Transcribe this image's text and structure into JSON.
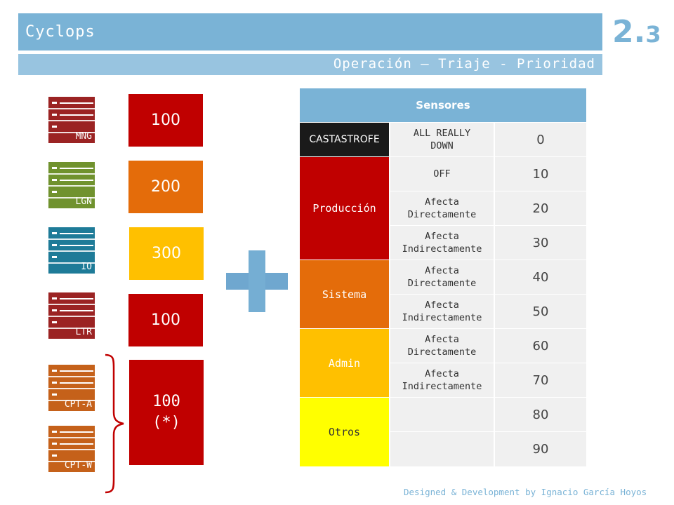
{
  "header": {
    "title": "Cyclops",
    "subtitle": "Operación – Triaje - Prioridad",
    "section_major": "2.",
    "section_minor": "3"
  },
  "colors": {
    "accent": "#7ab3d6",
    "red": "#c00000",
    "orange": "#e46c0a",
    "amber": "#ffc000",
    "yellow": "#ffff00",
    "server_red": "#9b2323",
    "server_green": "#70922e",
    "server_teal": "#1e7b98",
    "server_orange": "#c5611a"
  },
  "servers": [
    {
      "label": "MNG",
      "icon": "server-rack-icon"
    },
    {
      "label": "LGN",
      "icon": "server-rack-icon"
    },
    {
      "label": "IO",
      "icon": "server-rack-icon"
    },
    {
      "label": "LTR",
      "icon": "server-rack-icon"
    },
    {
      "label": "CPT-A",
      "icon": "server-rack-icon"
    },
    {
      "label": "CPT-W",
      "icon": "server-rack-icon"
    }
  ],
  "priorities": [
    {
      "value": "100"
    },
    {
      "value": "200"
    },
    {
      "value": "300"
    },
    {
      "value": "100"
    },
    {
      "value": "100\n(*)"
    }
  ],
  "plus_icon": "plus-icon",
  "bracket_icon": "curly-brace-icon",
  "table": {
    "header": "Sensores",
    "categories": [
      "CASTASTROFE",
      "Producción",
      "Sistema",
      "Admin",
      "Otros"
    ],
    "rows": [
      {
        "desc": "ALL REALLY\nDOWN",
        "value": "0"
      },
      {
        "desc": "OFF",
        "value": "10"
      },
      {
        "desc": "Afecta\nDirectamente",
        "value": "20"
      },
      {
        "desc": "Afecta\nIndirectamente",
        "value": "30"
      },
      {
        "desc": "Afecta\nDirectamente",
        "value": "40"
      },
      {
        "desc": "Afecta\nIndirectamente",
        "value": "50"
      },
      {
        "desc": "Afecta\nDirectamente",
        "value": "60"
      },
      {
        "desc": "Afecta\nIndirectamente",
        "value": "70"
      },
      {
        "desc": "",
        "value": "80"
      },
      {
        "desc": "",
        "value": "90"
      }
    ]
  },
  "footer": "Designed & Development by Ignacio García Hoyos"
}
